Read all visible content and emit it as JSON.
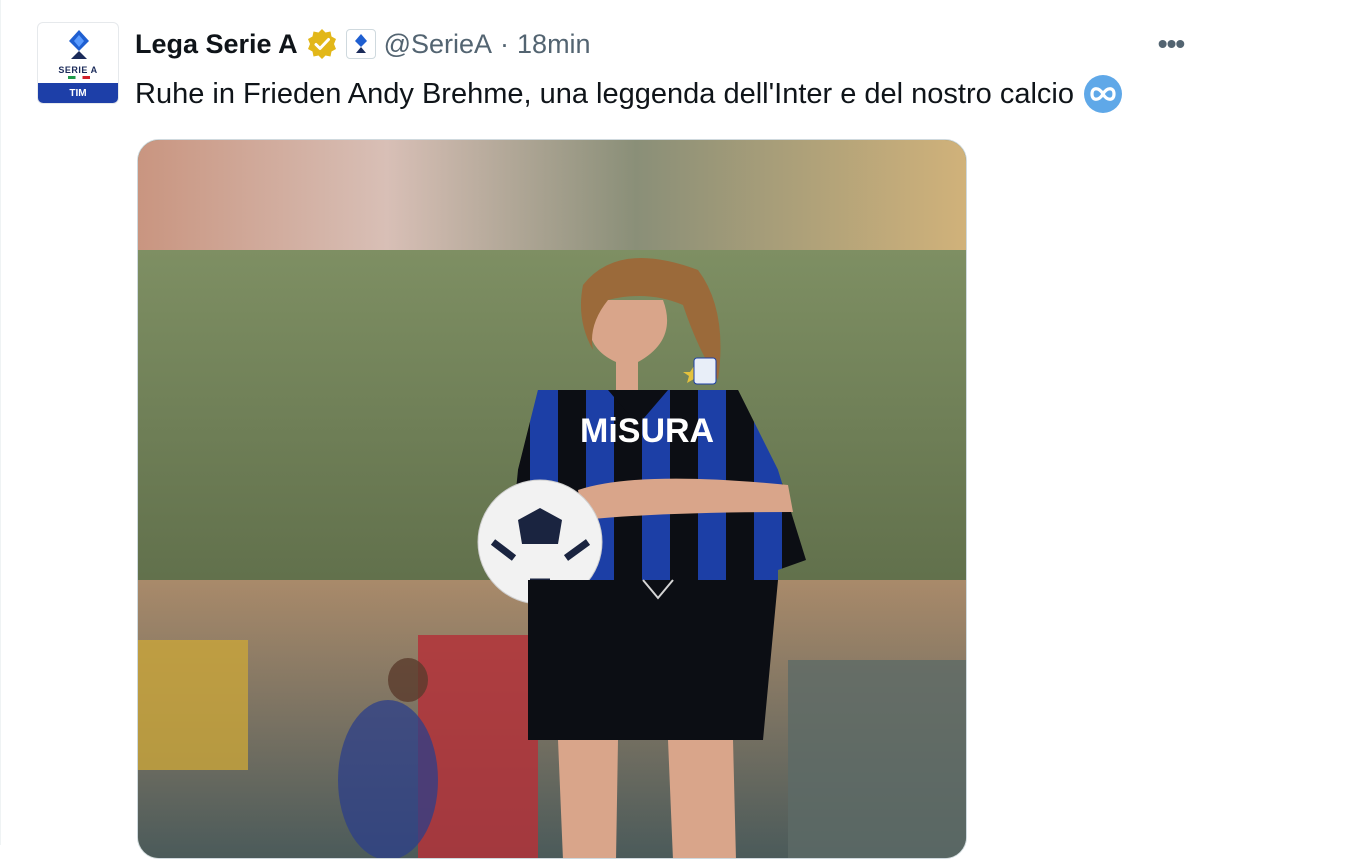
{
  "tweet": {
    "author": {
      "display_name": "Lega Serie A",
      "handle": "@SerieA",
      "verified_icon": "gold-verified-badge-icon",
      "affiliate_icon": "serie-a-affiliate-badge-icon",
      "avatar": {
        "icon": "serie-a-logo",
        "brand": "SERIE A",
        "sponsor": "TIM"
      }
    },
    "separator": "·",
    "time": "18min",
    "more_icon": "more-horizontal-icon",
    "more_label": "•••",
    "text": "Ruhe in Frieden Andy Brehme, una leggenda dell'Inter e del nostro calcio",
    "emoji_icon": "infinity-emoji-icon",
    "media": {
      "sponsor_text": "MiSURA"
    }
  },
  "colors": {
    "text_primary": "#0f1419",
    "text_secondary": "#536471",
    "verified_gold": "#e2b719",
    "inter_blue": "#1c3fa6",
    "inter_black": "#0c0e14",
    "emoji_blue": "#5fa8e8"
  }
}
